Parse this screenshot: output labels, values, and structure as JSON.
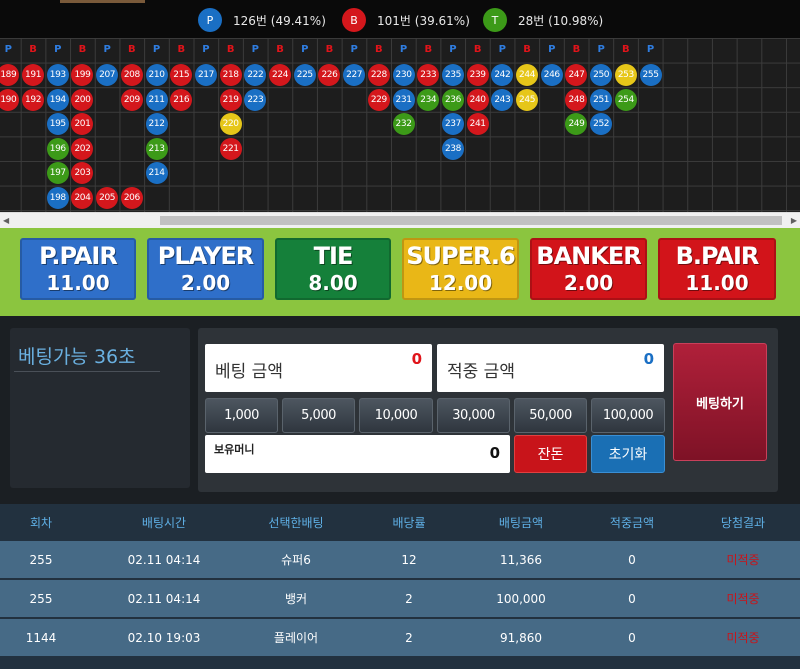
{
  "stats": [
    {
      "letter": "P",
      "text": "126번 (49.41%)",
      "color": "#1a6fc4"
    },
    {
      "letter": "B",
      "text": "101번 (39.61%)",
      "color": "#d4171c"
    },
    {
      "letter": "T",
      "text": "28번 (10.98%)",
      "color": "#3c9a18"
    }
  ],
  "road": {
    "headers": [
      "P",
      "B",
      "P",
      "B",
      "P",
      "B",
      "P",
      "B",
      "P",
      "B",
      "P",
      "B",
      "P",
      "B",
      "P",
      "B",
      "P",
      "B",
      "P",
      "B",
      "P",
      "B",
      "P",
      "B",
      "P",
      "B",
      "P"
    ],
    "colors": {
      "P": "#1a6fc4",
      "B": "#d4171c",
      "T": "#3c9a18",
      "S": "#e6c619"
    },
    "columns": [
      [
        {
          "n": "189",
          "c": "B"
        },
        {
          "n": "190",
          "c": "B"
        }
      ],
      [
        {
          "n": "191",
          "c": "B"
        },
        {
          "n": "192",
          "c": "B"
        }
      ],
      [
        {
          "n": "193",
          "c": "P"
        },
        {
          "n": "194",
          "c": "P"
        },
        {
          "n": "195",
          "c": "P"
        },
        {
          "n": "196",
          "c": "T"
        },
        {
          "n": "197",
          "c": "T"
        },
        {
          "n": "198",
          "c": "P"
        }
      ],
      [
        {
          "n": "199",
          "c": "B"
        },
        {
          "n": "200",
          "c": "B"
        },
        {
          "n": "201",
          "c": "B"
        },
        {
          "n": "202",
          "c": "B"
        },
        {
          "n": "203",
          "c": "B"
        },
        {
          "n": "204",
          "c": "B"
        }
      ],
      [
        {
          "n": "207",
          "c": "P"
        },
        null,
        null,
        null,
        null,
        {
          "n": "205",
          "c": "B"
        }
      ],
      [
        {
          "n": "208",
          "c": "B"
        },
        {
          "n": "209",
          "c": "B"
        },
        null,
        null,
        null,
        {
          "n": "206",
          "c": "B"
        }
      ],
      [
        {
          "n": "210",
          "c": "P"
        },
        {
          "n": "211",
          "c": "P"
        },
        {
          "n": "212",
          "c": "P"
        },
        {
          "n": "213",
          "c": "T"
        },
        {
          "n": "214",
          "c": "P"
        }
      ],
      [
        {
          "n": "215",
          "c": "B"
        },
        {
          "n": "216",
          "c": "B"
        }
      ],
      [
        {
          "n": "217",
          "c": "P"
        }
      ],
      [
        {
          "n": "218",
          "c": "B"
        },
        {
          "n": "219",
          "c": "B"
        },
        {
          "n": "220",
          "c": "S"
        },
        {
          "n": "221",
          "c": "B"
        }
      ],
      [
        {
          "n": "222",
          "c": "P"
        },
        {
          "n": "223",
          "c": "P"
        }
      ],
      [
        {
          "n": "224",
          "c": "B"
        }
      ],
      [
        {
          "n": "225",
          "c": "P"
        }
      ],
      [
        {
          "n": "226",
          "c": "B"
        }
      ],
      [
        {
          "n": "227",
          "c": "P"
        }
      ],
      [
        {
          "n": "228",
          "c": "B"
        },
        {
          "n": "229",
          "c": "B"
        }
      ],
      [
        {
          "n": "230",
          "c": "P"
        },
        {
          "n": "231",
          "c": "P"
        },
        {
          "n": "232",
          "c": "T"
        }
      ],
      [
        {
          "n": "233",
          "c": "B"
        },
        {
          "n": "234",
          "c": "T"
        }
      ],
      [
        {
          "n": "235",
          "c": "P"
        },
        {
          "n": "236",
          "c": "T"
        },
        {
          "n": "237",
          "c": "P"
        },
        {
          "n": "238",
          "c": "P"
        }
      ],
      [
        {
          "n": "239",
          "c": "B"
        },
        {
          "n": "240",
          "c": "B"
        },
        {
          "n": "241",
          "c": "B"
        }
      ],
      [
        {
          "n": "242",
          "c": "P"
        },
        {
          "n": "243",
          "c": "P"
        }
      ],
      [
        {
          "n": "244",
          "c": "S"
        },
        {
          "n": "245",
          "c": "S"
        }
      ],
      [
        {
          "n": "246",
          "c": "P"
        }
      ],
      [
        {
          "n": "247",
          "c": "B"
        },
        {
          "n": "248",
          "c": "B"
        },
        {
          "n": "249",
          "c": "T"
        }
      ],
      [
        {
          "n": "250",
          "c": "P"
        },
        {
          "n": "251",
          "c": "P"
        },
        {
          "n": "252",
          "c": "P"
        }
      ],
      [
        {
          "n": "253",
          "c": "S"
        },
        {
          "n": "254",
          "c": "T"
        }
      ],
      [
        {
          "n": "255",
          "c": "P"
        }
      ]
    ]
  },
  "bet_types": [
    {
      "name": "P.PAIR",
      "odds": "11.00",
      "color": "#2f6fc9"
    },
    {
      "name": "PLAYER",
      "odds": "2.00",
      "color": "#2f6fc9"
    },
    {
      "name": "TIE",
      "odds": "8.00",
      "color": "#15803a"
    },
    {
      "name": "SUPER.6",
      "odds": "12.00",
      "color": "#e9b717"
    },
    {
      "name": "BANKER",
      "odds": "2.00",
      "color": "#d2141a"
    },
    {
      "name": "B.PAIR",
      "odds": "11.00",
      "color": "#d2141a"
    }
  ],
  "timer_label": "베팅가능 36초",
  "bet_amount": {
    "label": "베팅 금액",
    "value": "0"
  },
  "win_amount": {
    "label": "적중 금액",
    "value": "0"
  },
  "chips": [
    "1,000",
    "5,000",
    "10,000",
    "30,000",
    "50,000",
    "100,000"
  ],
  "balance": {
    "label": "보유머니",
    "value": "0"
  },
  "buttons": {
    "change": "잔돈",
    "reset": "초기화",
    "place": "베팅하기"
  },
  "table": {
    "headers": [
      "회차",
      "배팅시간",
      "선택한배팅",
      "배당률",
      "배팅금액",
      "적중금액",
      "당첨결과"
    ],
    "rows": [
      [
        "255",
        "02.11 04:14",
        "슈퍼6",
        "12",
        "11,366",
        "0",
        "미적중"
      ],
      [
        "255",
        "02.11 04:14",
        "뱅커",
        "2",
        "100,000",
        "0",
        "미적중"
      ],
      [
        "1144",
        "02.10 19:03",
        "플레이어",
        "2",
        "91,860",
        "0",
        "미적중"
      ]
    ]
  }
}
